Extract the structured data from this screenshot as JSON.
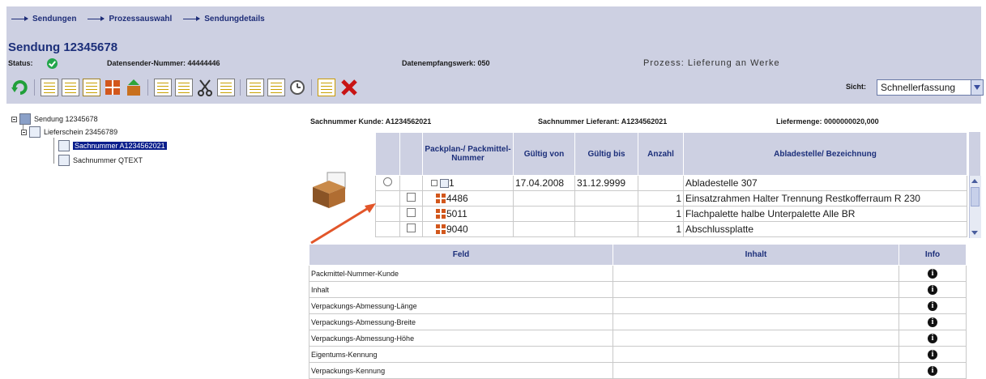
{
  "breadcrumb": [
    "Sendungen",
    "Prozessauswahl",
    "Sendungdetails"
  ],
  "page_title": "Sendung 12345678",
  "status": {
    "label": "Status:",
    "sender_label": "Datensender-Nummer: 44444446",
    "receiver_label": "Datenempfangswerk: 050",
    "process_label": "Prozess: Lieferung an Werke"
  },
  "toolbar": {
    "view_label": "Sicht:",
    "view_value": "Schnellerfassung",
    "icons": [
      "refresh-icon",
      "document-icon",
      "print-icon",
      "stack-icon",
      "grid-add-icon",
      "export-icon",
      "copy-icon",
      "copy-multiple-icon",
      "cut-icon",
      "paste-icon",
      "table-icon",
      "label-icon",
      "history-icon",
      "transfer-icon",
      "delete-icon"
    ]
  },
  "tree": {
    "root": "Sendung 12345678",
    "level1": "Lieferschein 23456789",
    "level2": [
      "Sachnummer A1234562021",
      "Sachnummer QTEXT"
    ]
  },
  "summary": {
    "customer_part": "Sachnummer Kunde: A1234562021",
    "supplier_part": "Sachnummer Lieferant: A1234562021",
    "quantity": "Liefermenge: 0000000020,000"
  },
  "pack_table": {
    "headers": [
      "Packplan-/ Packmittel- Nummer",
      "Gültig von",
      "Gültig bis",
      "Anzahl",
      "Abladestelle/ Bezeichnung"
    ],
    "rows": [
      {
        "number": "1",
        "valid_from": "17.04.2008",
        "valid_to": "31.12.9999",
        "count": "",
        "desc": "Abladestelle 307"
      },
      {
        "number": "4486",
        "valid_from": "",
        "valid_to": "",
        "count": "1",
        "desc": "Einsatzrahmen Halter Trennung Restkofferraum R 230"
      },
      {
        "number": "5011",
        "valid_from": "",
        "valid_to": "",
        "count": "1",
        "desc": "Flachpalette halbe Unterpalette Alle BR"
      },
      {
        "number": "9040",
        "valid_from": "",
        "valid_to": "",
        "count": "1",
        "desc": "Abschlussplatte"
      }
    ]
  },
  "field_table": {
    "headers": [
      "Feld",
      "Inhalt",
      "Info"
    ],
    "rows": [
      "Packmittel-Nummer-Kunde",
      "Inhalt",
      "Verpackungs-Abmessung-Länge",
      "Verpackungs-Abmessung-Breite",
      "Verpackungs-Abmessung-Höhe",
      "Eigentums-Kennung",
      "Verpackungs-Kennung"
    ],
    "info_glyph": "i"
  },
  "colors": {
    "band": "#cdd0e2",
    "title": "#1c2f7a",
    "selected": "#0a1e8c",
    "arrow": "#e2562a",
    "delete": "#c81414"
  }
}
